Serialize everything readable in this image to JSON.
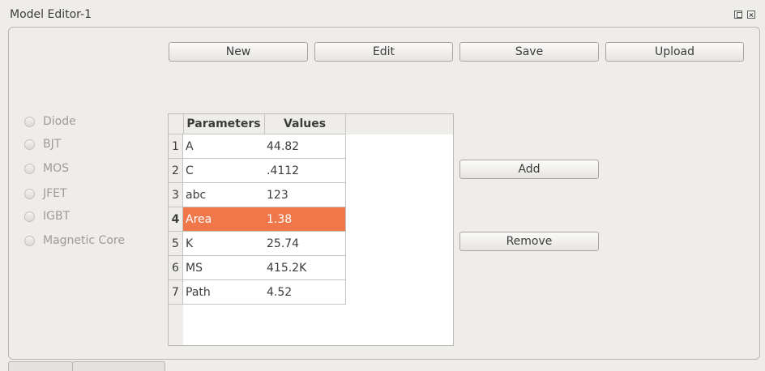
{
  "window": {
    "title": "Model Editor-1"
  },
  "toolbar": {
    "new_label": "New",
    "edit_label": "Edit",
    "save_label": "Save",
    "upload_label": "Upload"
  },
  "device_types": [
    {
      "label": "Diode",
      "checked": false
    },
    {
      "label": "BJT",
      "checked": false
    },
    {
      "label": "MOS",
      "checked": false
    },
    {
      "label": "JFET",
      "checked": false
    },
    {
      "label": "IGBT",
      "checked": false
    },
    {
      "label": "Magnetic Core",
      "checked": false
    }
  ],
  "table": {
    "columns": [
      "Parameters",
      "Values"
    ],
    "rows": [
      {
        "num": "1",
        "param": "A",
        "value": "44.82"
      },
      {
        "num": "2",
        "param": "C",
        "value": ".4112"
      },
      {
        "num": "3",
        "param": "abc",
        "value": "123"
      },
      {
        "num": "4",
        "param": "Area",
        "value": "1.38"
      },
      {
        "num": "5",
        "param": "K",
        "value": "25.74"
      },
      {
        "num": "6",
        "param": "MS",
        "value": "415.2K"
      },
      {
        "num": "7",
        "param": "Path",
        "value": "4.52"
      }
    ],
    "selected_row": 4
  },
  "actions": {
    "add_label": "Add",
    "remove_label": "Remove"
  },
  "colors": {
    "selection": "#f0774a",
    "background": "#efedea"
  }
}
